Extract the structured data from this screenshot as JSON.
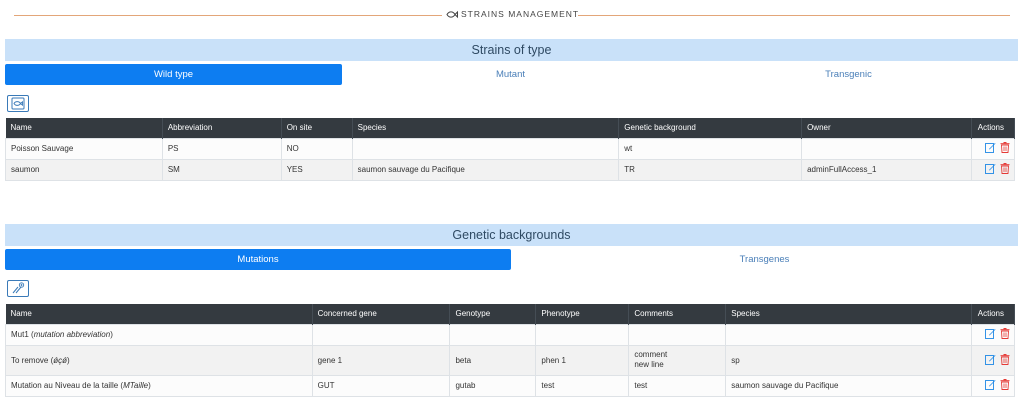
{
  "header": {
    "title": "STRAINS MANAGEMENT",
    "icon": "fish-icon"
  },
  "strains": {
    "section_title": "Strains of type",
    "tabs": [
      {
        "label": "Wild type",
        "active": true
      },
      {
        "label": "Mutant",
        "active": false
      },
      {
        "label": "Transgenic",
        "active": false
      }
    ],
    "add_button_icon": "add-strain-icon",
    "columns": [
      "Name",
      "Abbreviation",
      "On site",
      "Species",
      "Genetic background",
      "Owner",
      "Actions"
    ],
    "rows": [
      {
        "name": "Poisson Sauvage",
        "abbreviation": "PS",
        "on_site": "NO",
        "species": "",
        "genetic_background": "wt",
        "owner": ""
      },
      {
        "name": "saumon",
        "abbreviation": "SM",
        "on_site": "YES",
        "species": "saumon sauvage du Pacifique",
        "genetic_background": "TR",
        "owner": "adminFullAccess_1"
      }
    ]
  },
  "backgrounds": {
    "section_title": "Genetic backgrounds",
    "tabs": [
      {
        "label": "Mutations",
        "active": true
      },
      {
        "label": "Transgenes",
        "active": false
      }
    ],
    "add_button_icon": "add-mutation-icon",
    "columns": [
      "Name",
      "Concerned gene",
      "Genotype",
      "Phenotype",
      "Comments",
      "Species",
      "Actions"
    ],
    "rows": [
      {
        "name": "Mut1",
        "abbr": "mutation abbreviation",
        "gene": "",
        "genotype": "",
        "phenotype": "",
        "comment_line1": "",
        "comment_line2": "",
        "species": ""
      },
      {
        "name": "To remove",
        "abbr": "ǿçǿ",
        "gene": "gene 1",
        "genotype": "beta",
        "phenotype": "phen 1",
        "comment_line1": "comment",
        "comment_line2": "new line",
        "species": "sp"
      },
      {
        "name": "Mutation au Niveau de la taille",
        "abbr": "MTaille",
        "gene": "GUT",
        "genotype": "gutab",
        "phenotype": "test",
        "comment_line1": "test",
        "comment_line2": "",
        "species": "saumon sauvage du Pacifique"
      }
    ]
  },
  "colors": {
    "accent": "#0d7df1",
    "band": "#c9e1f9",
    "table_header": "#343a40",
    "edit": "#1e88e5",
    "delete": "#e53935",
    "divider": "#e3a679"
  }
}
